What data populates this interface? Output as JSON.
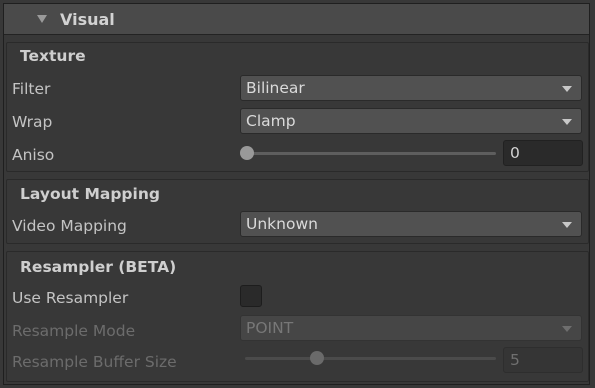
{
  "header": {
    "title": "Visual"
  },
  "texture": {
    "title": "Texture",
    "filter": {
      "label": "Filter",
      "value": "Bilinear"
    },
    "wrap": {
      "label": "Wrap",
      "value": "Clamp"
    },
    "aniso": {
      "label": "Aniso",
      "value": "0",
      "slider_fraction": 0.0
    }
  },
  "layout_mapping": {
    "title": "Layout Mapping",
    "video_mapping": {
      "label": "Video Mapping",
      "value": "Unknown"
    }
  },
  "resampler": {
    "title": "Resampler (BETA)",
    "use_resampler": {
      "label": "Use Resampler",
      "checked": false
    },
    "resample_mode": {
      "label": "Resample Mode",
      "value": "POINT",
      "enabled": false
    },
    "buffer_size": {
      "label": "Resample Buffer Size",
      "value": "5",
      "enabled": false
    }
  },
  "icons": {
    "foldout": "triangle-down-icon",
    "dropdown": "chevron-down-icon"
  }
}
